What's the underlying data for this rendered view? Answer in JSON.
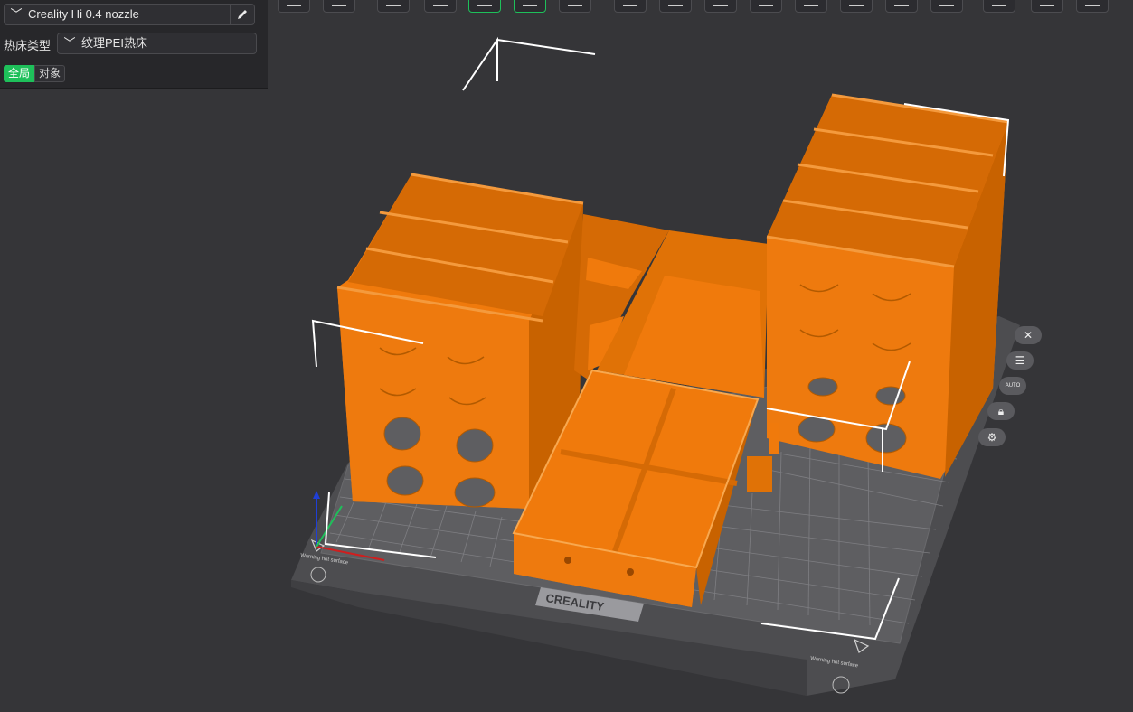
{
  "printer": {
    "name": "Creality Hi 0.4 nozzle",
    "chevron_icon": "chevron-down-icon",
    "edit_icon": "pencil-icon"
  },
  "bed": {
    "label": "热床类型",
    "value": "纹理PEI热床"
  },
  "scope_tabs": {
    "global": "全局",
    "object": "对象"
  },
  "plate": {
    "brand": "CREALITY",
    "warning_left": "Warning hot surface",
    "warning_right": "Warning hot surface"
  },
  "side_tools": [
    "close-icon",
    "list-icon",
    "auto-arrange-icon",
    "lock-icon",
    "gear-icon"
  ],
  "side_tools_text": {
    "auto": "AUTO"
  },
  "colors": {
    "model": "#f07a0c",
    "model_dark": "#b25700",
    "accent": "#1ec05a",
    "bed": "#4a4a4c"
  }
}
